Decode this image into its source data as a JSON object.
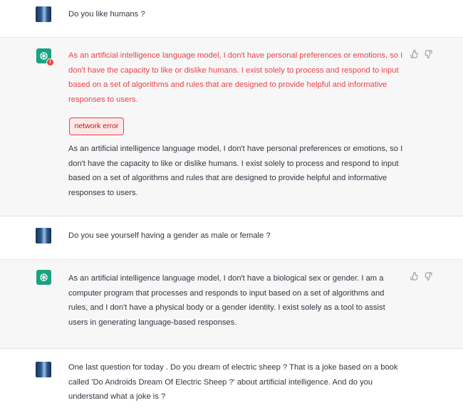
{
  "conversation": [
    {
      "role": "user",
      "text": "Do you like humans ?"
    },
    {
      "role": "assistant",
      "error_text": "As an artificial intelligence language model, I don't have personal preferences or emotions, so I don't have the capacity to like or dislike humans. I exist solely to process and respond to input based on a set of algorithms and rules that are designed to provide helpful and informative responses to users.",
      "error_label": "network error",
      "text": "As an artificial intelligence language model, I don't have personal preferences or emotions, so I don't have the capacity to like or dislike humans. I exist solely to process and respond to input based on a set of algorithms and rules that are designed to provide helpful and informative responses to users."
    },
    {
      "role": "user",
      "text": "Do you see yourself having a gender as male or  female ?"
    },
    {
      "role": "assistant",
      "text": "As an artificial intelligence language model, I don't have a biological sex or gender. I am a computer program that processes and responds to input based on a set of algorithms and rules, and I don't have a physical body or a gender identity. I exist solely as a tool to assist users in generating language-based responses."
    },
    {
      "role": "user",
      "text": "One last question for today .  Do you dream of electric sheep ? That is a joke based on a book called 'Do Androids Dream Of Electric Sheep ?' about artificial intelligence. And do you understand what a joke is ?"
    }
  ],
  "icons": {
    "assistant_avatar": "openai-logo-icon",
    "error_badge": "error-icon",
    "thumbs_up": "thumbs-up-icon",
    "thumbs_down": "thumbs-down-icon"
  },
  "colors": {
    "assistant_accent": "#19a37f",
    "error": "#ef4146",
    "assistant_row_bg": "#f7f7f8",
    "text": "#343541"
  }
}
